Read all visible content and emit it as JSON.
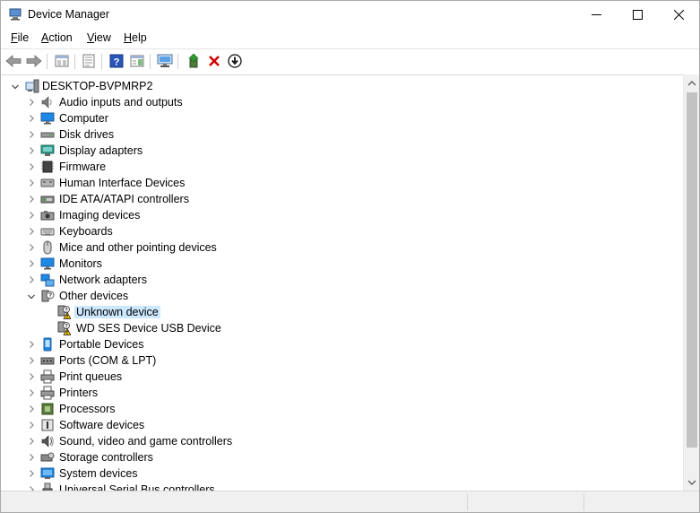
{
  "window": {
    "title": "Device Manager"
  },
  "menu": [
    {
      "pre": "",
      "u": "F",
      "post": "ile",
      "full": "File"
    },
    {
      "pre": "",
      "u": "A",
      "post": "ction",
      "full": "Action"
    },
    {
      "pre": "",
      "u": "V",
      "post": "iew",
      "full": "View"
    },
    {
      "pre": "",
      "u": "H",
      "post": "elp",
      "full": "Help"
    }
  ],
  "toolbar": [
    {
      "name": "back-button",
      "icon": "arrow-left-icon"
    },
    {
      "name": "forward-button",
      "icon": "arrow-right-icon"
    },
    {
      "name": "show-hide-console-tree-button",
      "icon": "console-tree-icon"
    },
    {
      "name": "properties-button",
      "icon": "properties-icon"
    },
    {
      "name": "help-button",
      "icon": "help-icon"
    },
    {
      "name": "action-pane-button",
      "icon": "action-pane-icon"
    },
    {
      "name": "scan-hardware-button",
      "icon": "monitor-scan-icon"
    },
    {
      "name": "update-driver-button",
      "icon": "update-driver-icon"
    },
    {
      "name": "uninstall-device-button",
      "icon": "red-x-icon"
    },
    {
      "name": "enable-device-button",
      "icon": "down-arrow-circle-icon"
    }
  ],
  "tree": {
    "root": {
      "label": "DESKTOP-BVPMRP2",
      "icon": "computer-tower-icon",
      "expanded": true
    },
    "items": [
      {
        "label": "Audio inputs and outputs",
        "icon": "speaker-icon",
        "level": 1,
        "expanded": false
      },
      {
        "label": "Computer",
        "icon": "monitor-icon",
        "level": 1,
        "expanded": false
      },
      {
        "label": "Disk drives",
        "icon": "disk-drive-icon",
        "level": 1,
        "expanded": false
      },
      {
        "label": "Display adapters",
        "icon": "display-adapter-icon",
        "level": 1,
        "expanded": false
      },
      {
        "label": "Firmware",
        "icon": "chip-icon",
        "level": 1,
        "expanded": false
      },
      {
        "label": "Human Interface Devices",
        "icon": "hid-icon",
        "level": 1,
        "expanded": false
      },
      {
        "label": "IDE ATA/ATAPI controllers",
        "icon": "ide-controller-icon",
        "level": 1,
        "expanded": false
      },
      {
        "label": "Imaging devices",
        "icon": "camera-icon",
        "level": 1,
        "expanded": false
      },
      {
        "label": "Keyboards",
        "icon": "keyboard-icon",
        "level": 1,
        "expanded": false
      },
      {
        "label": "Mice and other pointing devices",
        "icon": "mouse-icon",
        "level": 1,
        "expanded": false
      },
      {
        "label": "Monitors",
        "icon": "monitor-icon",
        "level": 1,
        "expanded": false
      },
      {
        "label": "Network adapters",
        "icon": "network-adapter-icon",
        "level": 1,
        "expanded": false
      },
      {
        "label": "Other devices",
        "icon": "unknown-device-icon",
        "level": 1,
        "expanded": true
      },
      {
        "label": "Unknown device",
        "icon": "warning-device-icon",
        "level": 2,
        "selected": true
      },
      {
        "label": "WD SES Device USB Device",
        "icon": "warning-device-icon",
        "level": 2
      },
      {
        "label": "Portable Devices",
        "icon": "portable-device-icon",
        "level": 1,
        "expanded": false
      },
      {
        "label": "Ports (COM & LPT)",
        "icon": "port-icon",
        "level": 1,
        "expanded": false
      },
      {
        "label": "Print queues",
        "icon": "printer-icon",
        "level": 1,
        "expanded": false
      },
      {
        "label": "Printers",
        "icon": "printer-icon",
        "level": 1,
        "expanded": false
      },
      {
        "label": "Processors",
        "icon": "processor-icon",
        "level": 1,
        "expanded": false
      },
      {
        "label": "Software devices",
        "icon": "software-device-icon",
        "level": 1,
        "expanded": false
      },
      {
        "label": "Sound, video and game controllers",
        "icon": "sound-icon",
        "level": 1,
        "expanded": false
      },
      {
        "label": "Storage controllers",
        "icon": "storage-controller-icon",
        "level": 1,
        "expanded": false
      },
      {
        "label": "System devices",
        "icon": "system-devices-icon",
        "level": 1,
        "expanded": false
      },
      {
        "label": "Universal Serial Bus controllers",
        "icon": "usb-icon",
        "level": 1,
        "expanded": false
      }
    ]
  },
  "colors": {
    "selection": "#cce8ff",
    "accent": "#1e88e5",
    "warning": "#f5c400",
    "uninstall": "#d00000"
  }
}
